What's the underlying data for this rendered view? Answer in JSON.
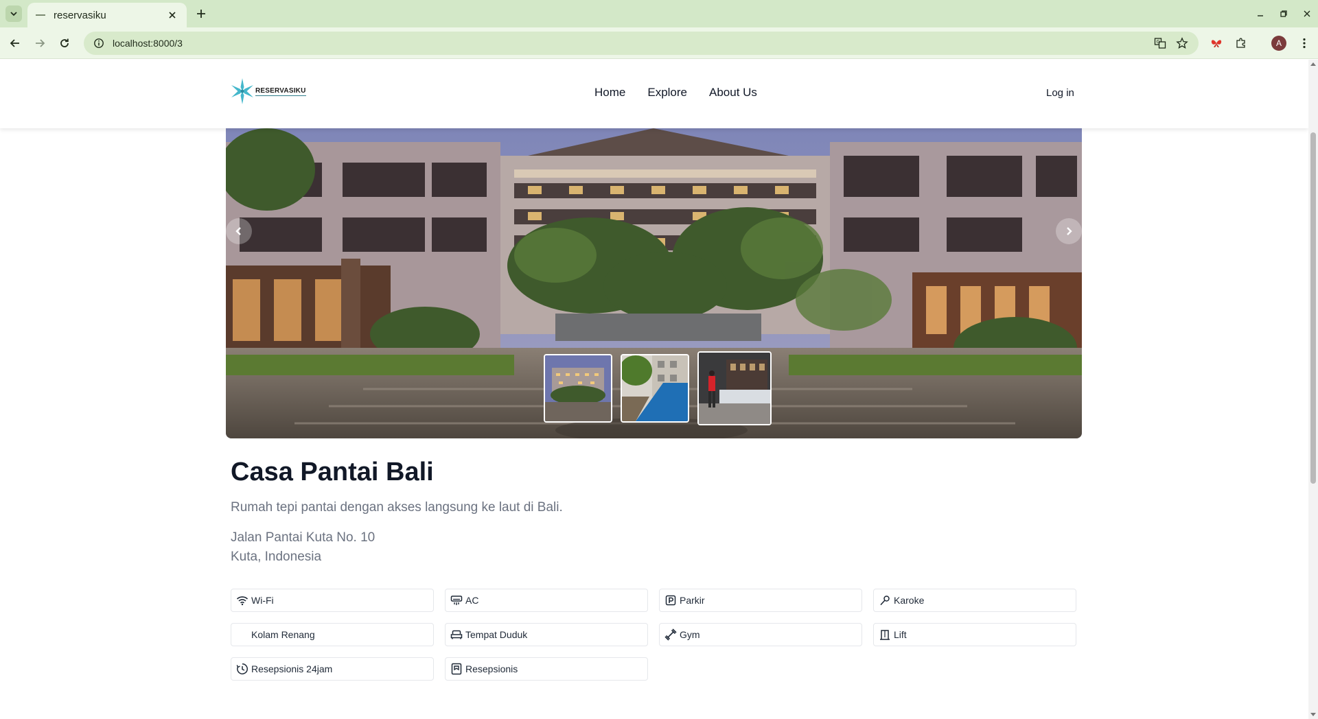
{
  "browser": {
    "tab_title": "reservasiku",
    "url": "localhost:8000/3",
    "profile_initial": "A"
  },
  "site": {
    "logo_text": "RESERVASIKU",
    "nav": [
      {
        "label": "Home"
      },
      {
        "label": "Explore"
      },
      {
        "label": "About Us"
      }
    ],
    "login_label": "Log in"
  },
  "carousel": {
    "thumbnail_count": 3,
    "active_index": 2
  },
  "hotel": {
    "name": "Casa Pantai Bali",
    "description": "Rumah tepi pantai dengan akses langsung ke laut di Bali.",
    "address_line1": "Jalan Pantai Kuta No. 10",
    "address_line2": "Kuta, Indonesia"
  },
  "facilities": [
    {
      "label": "Wi-Fi",
      "icon": "wifi-icon"
    },
    {
      "label": "AC",
      "icon": "ac-icon"
    },
    {
      "label": "Parkir",
      "icon": "parking-icon"
    },
    {
      "label": "Karoke",
      "icon": "microphone-icon"
    },
    {
      "label": "Kolam Renang",
      "icon": "pool-icon"
    },
    {
      "label": "Tempat Duduk",
      "icon": "sofa-icon"
    },
    {
      "label": "Gym",
      "icon": "dumbbell-icon"
    },
    {
      "label": "Lift",
      "icon": "elevator-icon"
    },
    {
      "label": "Resepsionis 24jam",
      "icon": "clock-24-icon"
    },
    {
      "label": "Resepsionis",
      "icon": "reception-icon"
    }
  ],
  "colors": {
    "chrome_tabbar": "#d3e8c8",
    "chrome_toolbar": "#edf6e7",
    "logo_accent": "#3bb4c9",
    "heading": "#111827",
    "muted_text": "#6b7280"
  }
}
